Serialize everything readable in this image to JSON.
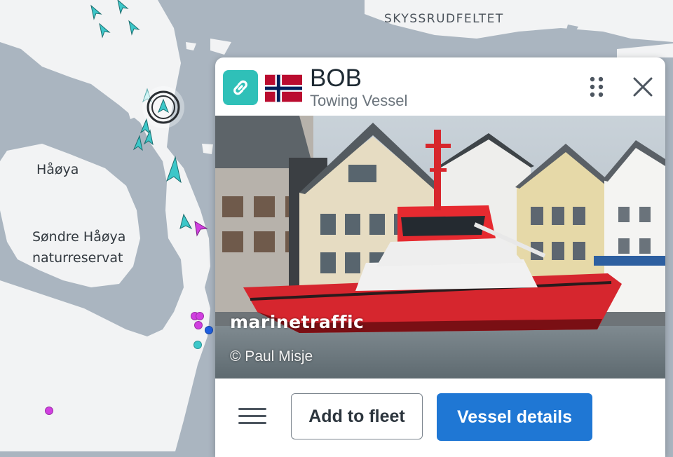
{
  "map": {
    "labels": {
      "region_top": "SKYSSRUDFELTET",
      "island": "Håøya",
      "reserve_line1": "Søndre Håøya",
      "reserve_line2": "naturreservat"
    },
    "colors": {
      "water": "#aab5c0",
      "land": "#f2f3f4",
      "vessel_cyan": "#3cc7c9",
      "vessel_magenta": "#d13fe0",
      "dot_blue": "#1f5fe0"
    }
  },
  "panel": {
    "vessel_name": "BOB",
    "vessel_type": "Towing Vessel",
    "flag": "Norway",
    "icons": {
      "link": "link-icon",
      "grid": "drag-grid-icon",
      "close": "close-icon",
      "menu": "hamburger-menu-icon"
    },
    "photo": {
      "watermark": "marinetraffic",
      "credit": "© Paul Misje"
    },
    "buttons": {
      "add_to_fleet": "Add to fleet",
      "vessel_details": "Vessel details"
    },
    "accent_color": "#1f77d4",
    "link_color": "#2fc0b8"
  }
}
